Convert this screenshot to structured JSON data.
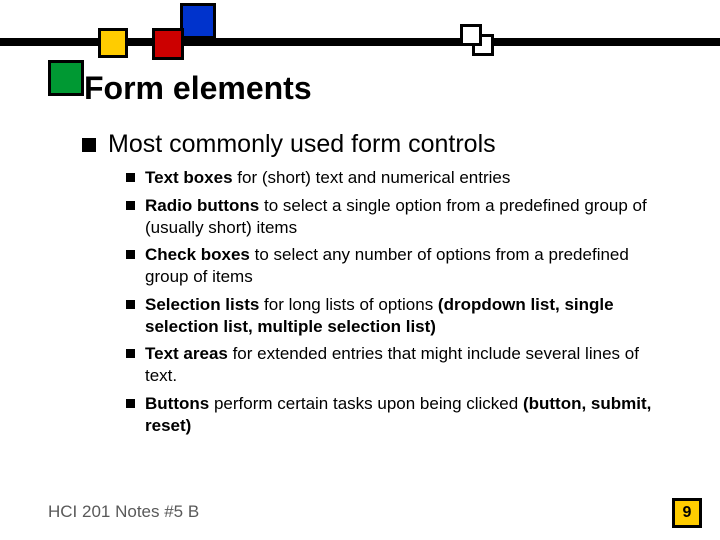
{
  "title": "Form elements",
  "bullet_main": "Most commonly used form controls",
  "items": [
    {
      "bold": "Text boxes",
      "rest": " for (short) text and numerical entries",
      "bold2": ""
    },
    {
      "bold": "Radio buttons",
      "rest": " to select a single option from a predefined group of (usually short) items",
      "bold2": ""
    },
    {
      "bold": "Check boxes",
      "rest": " to select any number of options from a predefined group of items",
      "bold2": ""
    },
    {
      "bold": "Selection lists",
      "rest": " for long lists of options ",
      "bold2": "(dropdown list, single selection list, multiple selection list)"
    },
    {
      "bold": "Text areas",
      "rest": " for extended entries that might include several lines of text.",
      "bold2": ""
    },
    {
      "bold": "Buttons",
      "rest": " perform certain tasks upon being clicked ",
      "bold2": "(button, submit, reset)"
    }
  ],
  "footer": "HCI 201 Notes #5 B",
  "page": "9"
}
